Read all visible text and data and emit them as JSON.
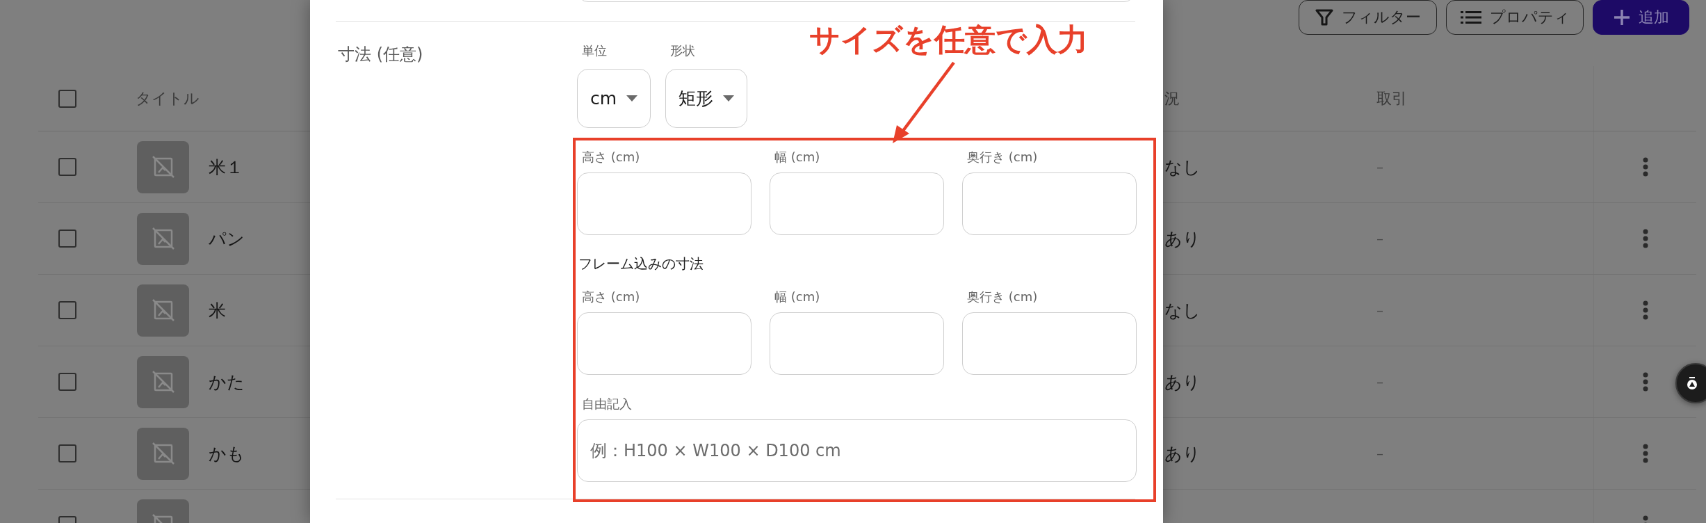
{
  "toolbar": {
    "buttons": [
      {
        "kind": "filter",
        "label": "フィルター"
      },
      {
        "kind": "properties",
        "label": "プロパティ"
      },
      {
        "kind": "add",
        "label": "追加"
      }
    ]
  },
  "table": {
    "columns": [
      "タイトル",
      "況",
      "取引"
    ],
    "select_all": {
      "checked": false
    },
    "rows": [
      {
        "checked": false,
        "title": "米１",
        "column_2": "なし",
        "column_3": "–"
      },
      {
        "checked": false,
        "title": "パン",
        "column_2": "あり",
        "column_3": "–"
      },
      {
        "checked": false,
        "title": "米",
        "column_2": "なし",
        "column_3": "–"
      },
      {
        "checked": false,
        "title": "かた",
        "column_2": "あり",
        "column_3": "–"
      },
      {
        "checked": false,
        "title": "かも",
        "column_2": "あり",
        "column_3": "–"
      },
      {
        "checked": false
      }
    ]
  },
  "dialog": {
    "section_label": "寸法 (任意)",
    "selects": [
      {
        "label": "単位",
        "value": "cm"
      },
      {
        "label": "形状",
        "value": "矩形"
      }
    ],
    "dimension_groups": [
      {
        "fields": [
          {
            "label": "高さ (cm)"
          },
          {
            "label": "幅 (cm)"
          },
          {
            "label": "奥行き (cm)"
          }
        ]
      },
      {
        "heading": "フレーム込みの寸法",
        "fields": [
          {
            "label": "高さ (cm)"
          },
          {
            "label": "幅 (cm)"
          },
          {
            "label": "奥行き (cm)"
          }
        ]
      }
    ],
    "free_entry": {
      "label": "自由記入",
      "placeholder": "例：H100 × W100 × D100 cm"
    }
  },
  "annotation": {
    "text": "サイズを任意で入力"
  }
}
